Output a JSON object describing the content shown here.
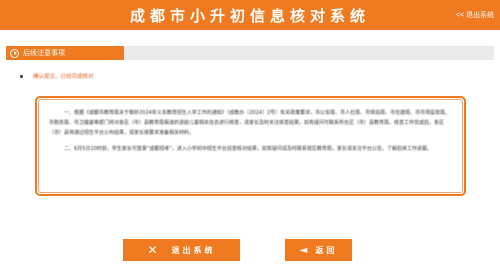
{
  "header": {
    "title": "成都市小升初信息核对系统",
    "logout_label": "<< 退出系统"
  },
  "section": {
    "tab_label": "后续注意事项"
  },
  "breadcrumb": {
    "text": "确认提交，已经完成核对"
  },
  "notice": {
    "paragraphs": [
      "一、根据《成都市教育局关于做好2024年义务教育招生入学工作的通知》（成教办〔2024〕2号）有关政策要求，市公安局、市人社局、市规自局、市住建局、市市场监管局、市税务局、市卫健委等部门将对各区（市）县教育局报送的适龄儿童相关信息进行核查，请家长及时关注核查结果，如有疑问可联系所在区（市）县教育局。核查工作完成后，各区（市）县将通过招生平台公布结果，请家长按要求准备相关材料。",
      "二、6月5日10时前，学生家长可登录“成都招考”，进入小学初中招生平台自查核对结果，如有疑问请及时联系辖区教育局，家长请关注平台公告，了解后续工作进展。"
    ]
  },
  "buttons": {
    "exit_label": "退出系统",
    "back_label": "返回"
  },
  "colors": {
    "accent": "#f07a1f",
    "bar_gray": "#eaeaea",
    "crumb_text": "#e05a1a"
  }
}
